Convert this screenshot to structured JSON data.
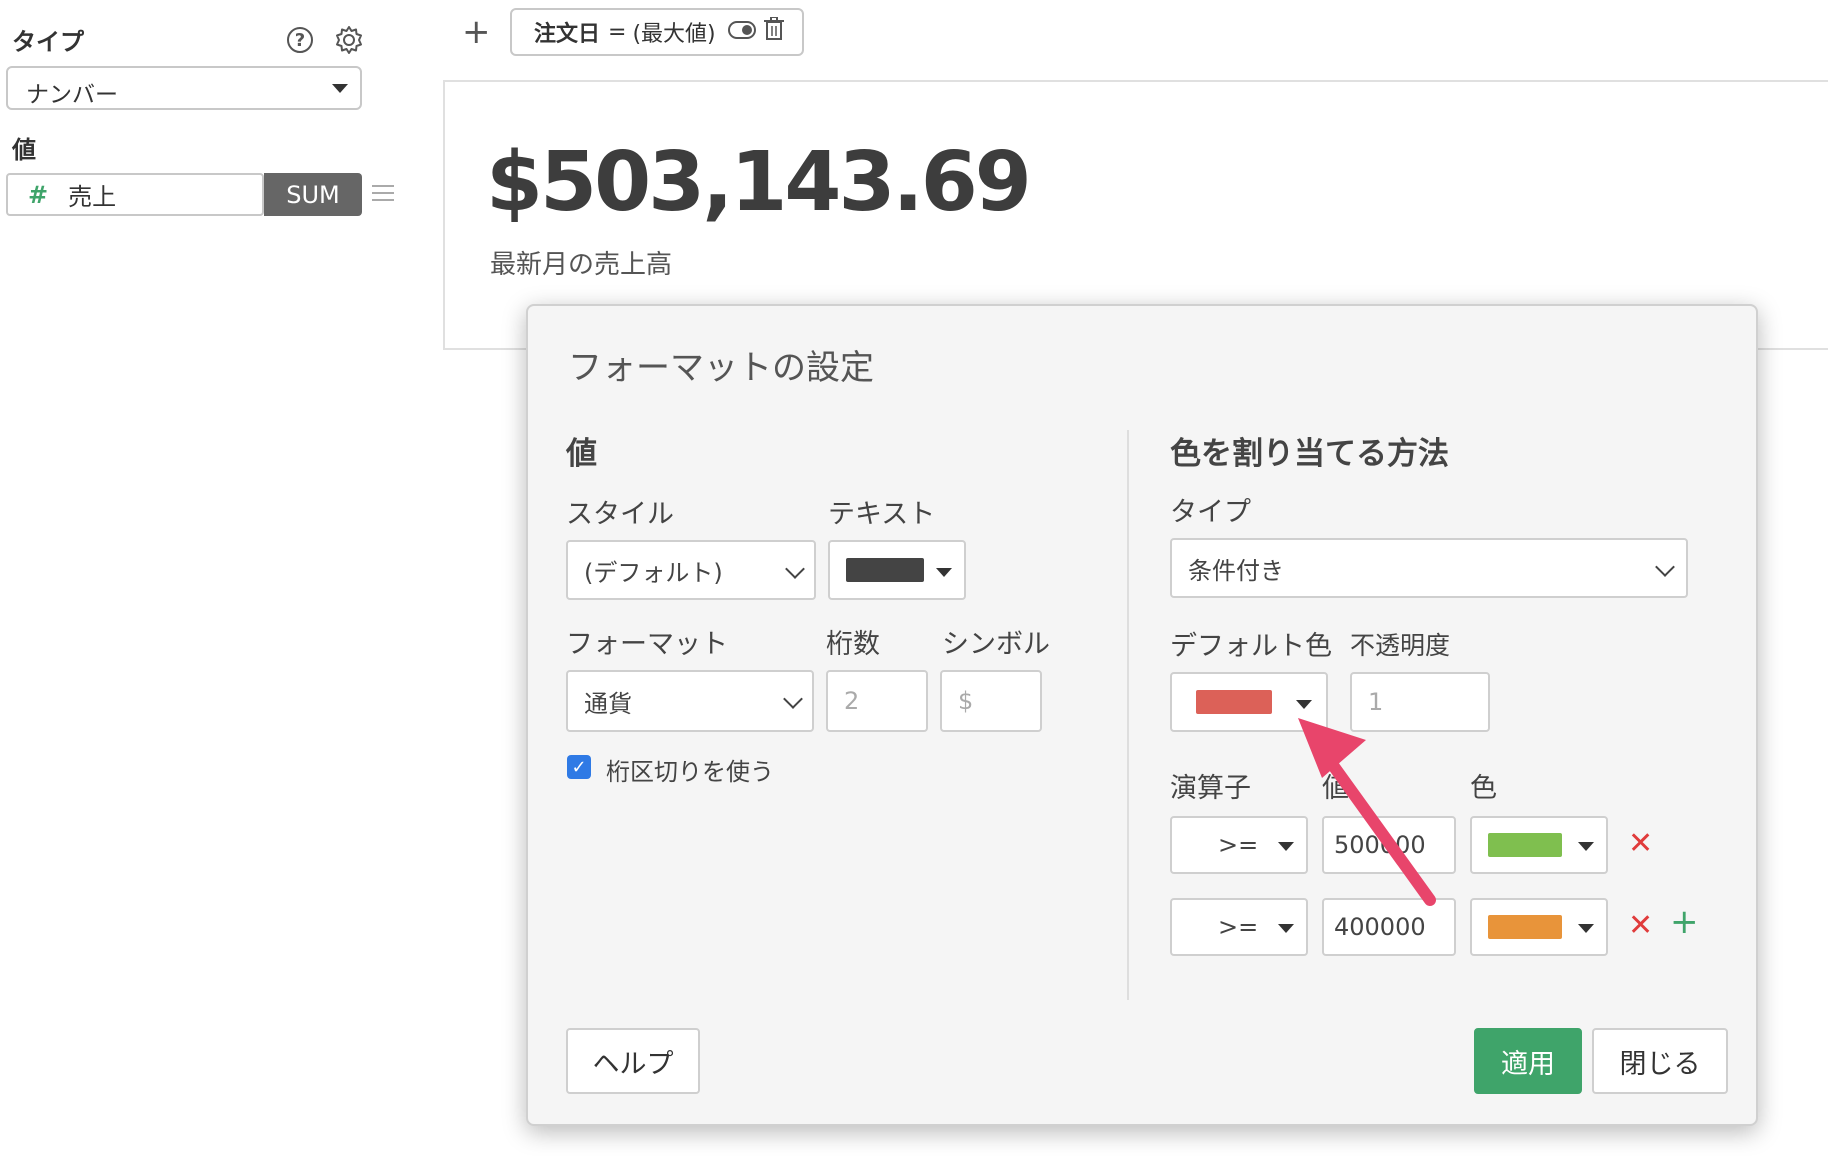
{
  "sidebar": {
    "type_label": "タイプ",
    "type_select_value": "ナンバー",
    "value_label": "値",
    "value_field": {
      "hash_symbol": "#",
      "name": "売上",
      "aggregation": "SUM"
    },
    "icons": {
      "help": "?",
      "settings": "gear-icon",
      "menu": "hamburger-icon"
    }
  },
  "toolbar": {
    "add_symbol": "+",
    "filter_chip": {
      "field": "注文日",
      "operator": "=",
      "value": "(最大値)"
    }
  },
  "card": {
    "value": "$503,143.69",
    "subtitle": "最新月の売上高"
  },
  "dialog": {
    "title": "フォーマットの設定",
    "left": {
      "section_title": "値",
      "style_label": "スタイル",
      "style_value": "(デフォルト)",
      "text_label": "テキスト",
      "text_color": "#444444",
      "format_label": "フォーマット",
      "format_value": "通貨",
      "digits_label": "桁数",
      "digits_placeholder": "2",
      "symbol_label": "シンボル",
      "symbol_placeholder": "$",
      "separator_checked": true,
      "separator_label": "桁区切りを使う"
    },
    "right": {
      "section_title": "色を割り当てる方法",
      "type_label": "タイプ",
      "type_value": "条件付き",
      "default_color_label": "デフォルト色",
      "default_color": "#dc6158",
      "opacity_label": "不透明度",
      "opacity_placeholder": "1",
      "operator_label": "演算子",
      "value_label": "値",
      "color_label": "色",
      "rules": [
        {
          "operator": ">=",
          "value": "500000",
          "color": "#7fbf4f"
        },
        {
          "operator": ">=",
          "value": "400000",
          "color": "#e8943a"
        }
      ],
      "remove_symbol": "✕",
      "add_symbol": "+"
    },
    "help_button": "ヘルプ",
    "apply_button": "適用",
    "close_button": "閉じる"
  },
  "annotation": {
    "arrow_color": "#e8456b"
  }
}
